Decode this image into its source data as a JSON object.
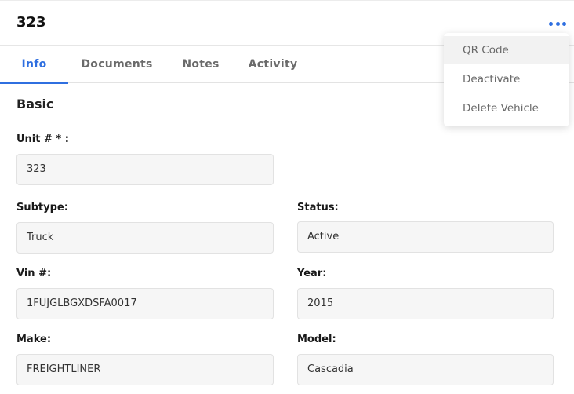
{
  "header": {
    "title": "323"
  },
  "tabs": [
    {
      "label": "Info",
      "active": true
    },
    {
      "label": "Documents",
      "active": false
    },
    {
      "label": "Notes",
      "active": false
    },
    {
      "label": "Activity",
      "active": false
    }
  ],
  "section": {
    "title": "Basic"
  },
  "fields": {
    "unit": {
      "label": "Unit # * :",
      "value": "323"
    },
    "subtype": {
      "label": "Subtype:",
      "value": "Truck"
    },
    "status": {
      "label": "Status:",
      "value": "Active"
    },
    "vin": {
      "label": "Vin #:",
      "value": "1FUJGLBGXDSFA0017"
    },
    "year": {
      "label": "Year:",
      "value": "2015"
    },
    "make": {
      "label": "Make:",
      "value": "FREIGHTLINER"
    },
    "model": {
      "label": "Model:",
      "value": "Cascadia"
    }
  },
  "menu": {
    "items": [
      {
        "label": "QR Code"
      },
      {
        "label": "Deactivate"
      },
      {
        "label": "Delete Vehicle"
      }
    ]
  },
  "colors": {
    "accent": "#2f6fe0"
  },
  "icons": {
    "more": "more-horizontal-icon"
  }
}
